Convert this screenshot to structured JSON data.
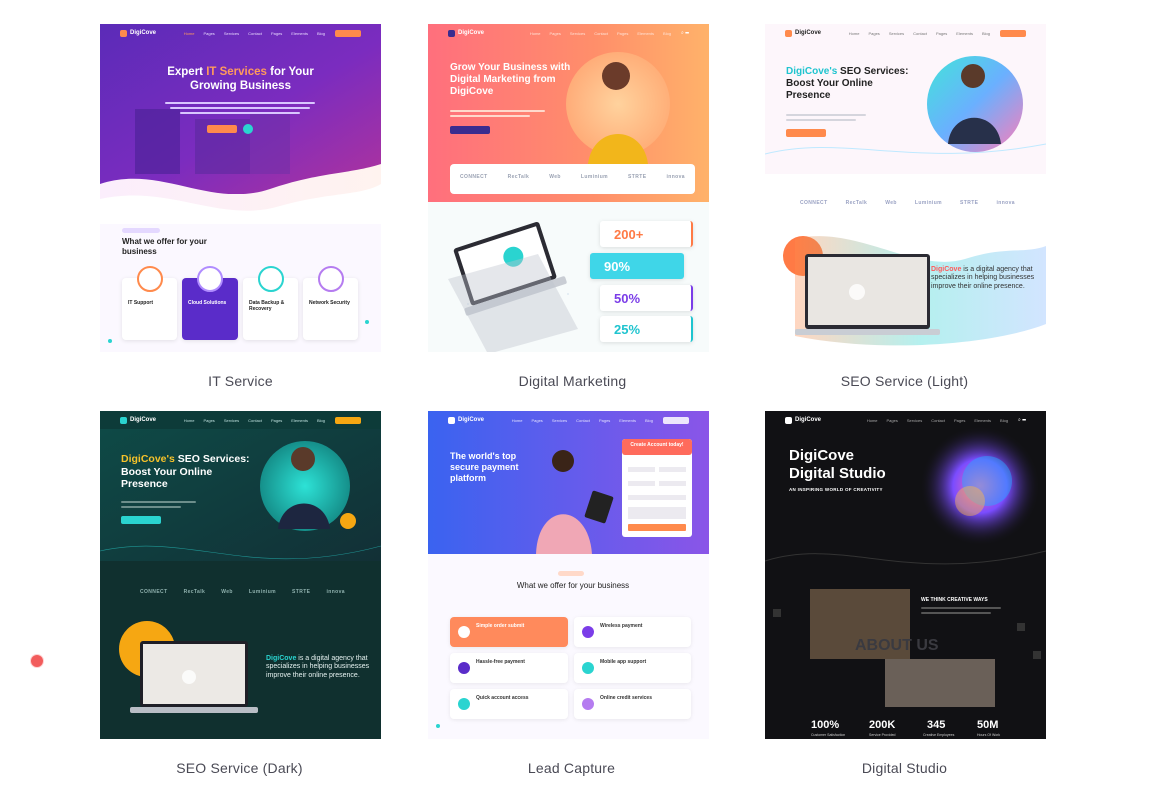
{
  "templates": [
    {
      "name": "IT Service"
    },
    {
      "name": "Digital Marketing"
    },
    {
      "name": "SEO Service (Light)"
    },
    {
      "name": "SEO Service (Dark)"
    },
    {
      "name": "Lead Capture"
    },
    {
      "name": "Digital Studio"
    }
  ],
  "brand": "DigiCove",
  "nav_links": [
    "Home",
    "Pages",
    "Services",
    "Contact",
    "Pages",
    "Elements",
    "Blog"
  ],
  "it_service": {
    "hero_line1_a": "Expert ",
    "hero_line1_b": "IT Services",
    "hero_line1_c": " for Your",
    "hero_line2": "Growing Business",
    "section_tag": "OUR SERVICES",
    "section_title": "What we offer for your business",
    "services": [
      "IT Support",
      "Cloud Solutions",
      "Data Backup & Recovery",
      "Network Security"
    ]
  },
  "digital_marketing": {
    "hero": "Grow Your Business with Digital Marketing from DigiCove",
    "logos": [
      "CONNECT",
      "RecTalk",
      "Web",
      "Luminium",
      "STRTE",
      "innova"
    ],
    "stats": [
      "200+",
      "90%",
      "50%",
      "25%"
    ]
  },
  "seo_light": {
    "hero_accent": "DigiCove's",
    "hero_rest": " SEO Services: Boost Your Online Presence",
    "logos": [
      "CONNECT",
      "RecTalk",
      "Web",
      "Luminium",
      "STRTE",
      "innova"
    ],
    "about_accent": "DigiCove",
    "about_rest": " is a digital agency that specializes in helping businesses improve their online presence."
  },
  "seo_dark": {
    "hero_accent": "DigiCove's",
    "hero_rest": " SEO Services: Boost Your Online Presence",
    "logos": [
      "CONNECT",
      "RecTalk",
      "Web",
      "Luminium",
      "STRTE",
      "innova"
    ],
    "about_accent": "DigiCove",
    "about_rest": " is a digital agency that specializes in helping businesses improve their online presence."
  },
  "lead_capture": {
    "hero": "The world's top secure payment platform",
    "form_title": "Create Account today!",
    "section_tag": "OUR SERVICES",
    "section_title": "What we offer for your business",
    "features": [
      "Simple order submit",
      "Wireless payment",
      "Hassle-free payment",
      "Mobile app support",
      "Quick account access",
      "Online credit services"
    ]
  },
  "digital_studio": {
    "title_line1": "DigiCove",
    "title_line2": "Digital Studio",
    "subtitle": "AN INSPIRING WORLD OF CREATIVITY",
    "section_heading": "WE THINK CREATIVE WAYS",
    "about": "ABOUT US",
    "stats": [
      {
        "value": "100%",
        "label": "Customer Satisfaction"
      },
      {
        "value": "200K",
        "label": "Service Provided"
      },
      {
        "value": "345",
        "label": "Creative Employees"
      },
      {
        "value": "50M",
        "label": "Hours Of Work"
      }
    ]
  },
  "colors": {
    "accent_orange": "#ff8a4c",
    "accent_purple": "#6b2fd6",
    "accent_teal": "#2ad4d0",
    "caption_text": "#4a4a55",
    "marker": "#f25c5c"
  }
}
